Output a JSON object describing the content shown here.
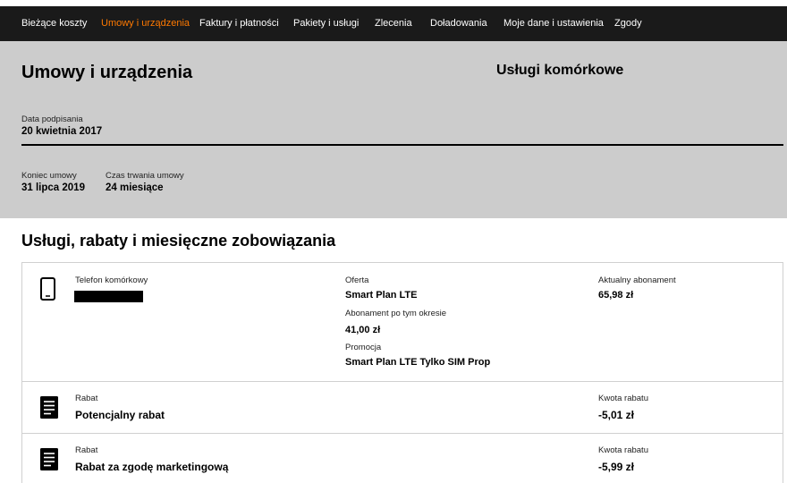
{
  "nav": {
    "items": [
      {
        "label": "Bieżące koszty",
        "active": false
      },
      {
        "label": "Umowy i urządzenia",
        "active": true
      },
      {
        "label": "Faktury i płatności",
        "active": false
      },
      {
        "label": "Pakiety i usługi",
        "active": false
      },
      {
        "label": "Zlecenia",
        "active": false
      },
      {
        "label": "Doładowania",
        "active": false
      },
      {
        "label": "Moje dane i ustawienia",
        "active": false
      },
      {
        "label": "Zgody",
        "active": false
      }
    ],
    "active_color": "#ff7900"
  },
  "summary": {
    "title": "Umowy i urządzenia",
    "subtitle": "Usługi komórkowe",
    "signing_date_label": "Data podpisania",
    "signing_date": "20 kwietnia 2017",
    "end_label": "Koniec umowy",
    "end_value": "31 lipca 2019",
    "duration_label": "Czas trwania umowy",
    "duration_value": "24 miesiące"
  },
  "services": {
    "heading": "Usługi, rabaty i miesięczne zobowiązania",
    "phone": {
      "icon": "mobile-phone-icon",
      "label": "Telefon komórkowy",
      "offer_label": "Oferta",
      "offer_value": "Smart Plan LTE",
      "after_label": "Abonament po tym okresie",
      "after_value": "41,00 zł",
      "promo_label": "Promocja",
      "promo_value": "Smart Plan LTE Tylko SIM Prop",
      "current_label": "Aktualny abonament",
      "current_value": "65,98 zł"
    },
    "discounts": [
      {
        "icon": "document-icon",
        "type_label": "Rabat",
        "name": "Potencjalny rabat",
        "amount_label": "Kwota rabatu",
        "amount": "-5,01 zł"
      },
      {
        "icon": "document-icon",
        "type_label": "Rabat",
        "name": "Rabat za zgodę marketingową",
        "amount_label": "Kwota rabatu",
        "amount": "-5,99 zł"
      }
    ]
  }
}
